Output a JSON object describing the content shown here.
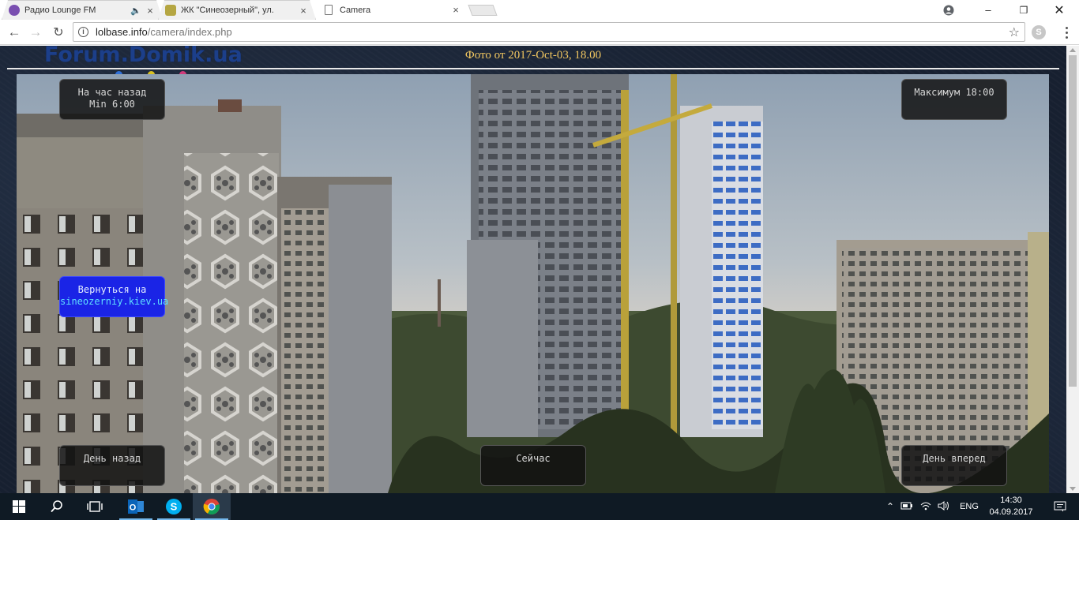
{
  "browser": {
    "tabs": [
      {
        "title": "Радио Lounge FM",
        "icon": "radio-favicon",
        "audio": true
      },
      {
        "title": "ЖК \"Синеозерный\", ул.",
        "icon": "forum-favicon"
      },
      {
        "title": "Camera",
        "icon": "page-favicon",
        "active": true
      }
    ],
    "url_host": "lolbase.info",
    "url_path": "/camera/index.php"
  },
  "page": {
    "logo_text": "Forum.Domik.ua",
    "caption": "Фото от 2017-Oct-03, 18.00",
    "buttons": {
      "hour_back_line1": "На час назад",
      "hour_back_line2": "Min 6:00",
      "max_label": "Максимум 18:00",
      "return_line1": "Вернуться на",
      "return_line2": "sineozerniy.kiev.ua",
      "day_back": "День назад",
      "now": "Сейчас",
      "day_forward": "День вперед"
    }
  },
  "taskbar": {
    "language": "ENG",
    "time": "14:30",
    "date": "04.09.2017"
  },
  "colors": {
    "caption": "#f2c760",
    "return_button": "#1a24e6",
    "taskbar": "#0f1a24"
  }
}
